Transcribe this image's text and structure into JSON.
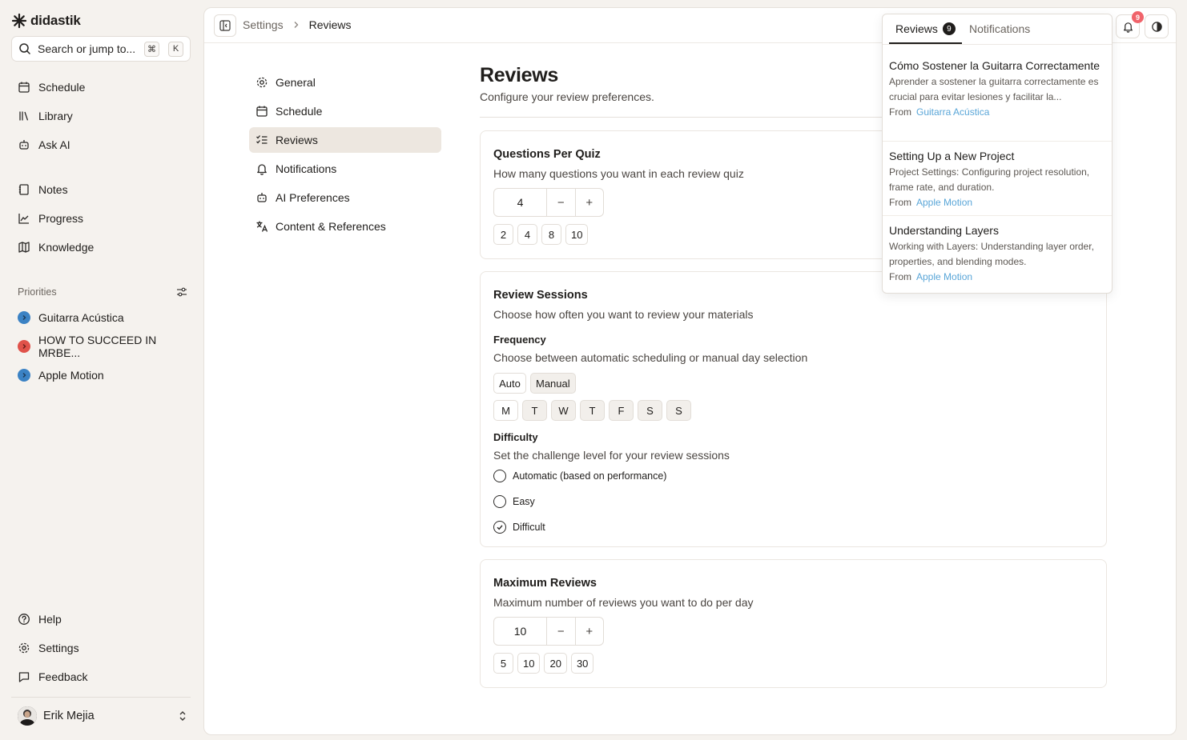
{
  "app": {
    "name": "didastik"
  },
  "search": {
    "placeholder": "Search or jump to...",
    "key1": "⌘",
    "key2": "K"
  },
  "sidebar": {
    "primary": [
      {
        "label": "Schedule",
        "icon": "calendar-icon"
      },
      {
        "label": "Library",
        "icon": "library-icon"
      },
      {
        "label": "Ask AI",
        "icon": "bot-icon"
      }
    ],
    "secondary": [
      {
        "label": "Notes",
        "icon": "notebook-icon"
      },
      {
        "label": "Progress",
        "icon": "chart-icon"
      },
      {
        "label": "Knowledge",
        "icon": "map-icon"
      }
    ],
    "priorities_label": "Priorities",
    "priorities": [
      {
        "label": "Guitarra Acústica",
        "color": "#3b82c4"
      },
      {
        "label": "HOW TO SUCCEED IN MRBE...",
        "color": "#e0524a"
      },
      {
        "label": "Apple Motion",
        "color": "#3b82c4"
      }
    ],
    "footer": [
      {
        "label": "Help",
        "icon": "help-circle-icon"
      },
      {
        "label": "Settings",
        "icon": "gear-icon"
      },
      {
        "label": "Feedback",
        "icon": "message-icon"
      }
    ],
    "user": {
      "name": "Erik Mejia"
    }
  },
  "breadcrumb": {
    "root": "Settings",
    "current": "Reviews"
  },
  "notifications": {
    "badge": "9"
  },
  "settings_nav": [
    {
      "label": "General",
      "icon": "gear-icon"
    },
    {
      "label": "Schedule",
      "icon": "calendar-icon"
    },
    {
      "label": "Reviews",
      "icon": "list-checks-icon",
      "active": true
    },
    {
      "label": "Notifications",
      "icon": "bell-icon"
    },
    {
      "label": "AI Preferences",
      "icon": "bot-icon"
    },
    {
      "label": "Content & References",
      "icon": "languages-icon"
    }
  ],
  "page": {
    "title": "Reviews",
    "subtitle": "Configure your review preferences."
  },
  "questions_per_quiz": {
    "title": "Questions Per Quiz",
    "description": "How many questions you want in each review quiz",
    "value": "4",
    "minus": "−",
    "plus": "+",
    "presets": [
      "2",
      "4",
      "8",
      "10"
    ]
  },
  "review_sessions": {
    "title": "Review Sessions",
    "description": "Choose how often you want to review your materials",
    "frequency_label": "Frequency",
    "frequency_desc": "Choose between automatic scheduling or manual day selection",
    "modes": [
      "Auto",
      "Manual"
    ],
    "selected_mode": "Manual",
    "days": [
      "M",
      "T",
      "W",
      "T",
      "F",
      "S",
      "S"
    ],
    "difficulty_label": "Difficulty",
    "difficulty_desc": "Set the challenge level for your review sessions",
    "difficulty_options": [
      "Automatic (based on performance)",
      "Easy",
      "Difficult"
    ],
    "difficulty_selected": "Difficult"
  },
  "maximum_reviews": {
    "title": "Maximum Reviews",
    "description": "Maximum number of reviews you want to do per day",
    "value": "10",
    "minus": "−",
    "plus": "+",
    "presets": [
      "5",
      "10",
      "20",
      "30"
    ]
  },
  "popover": {
    "tab_reviews": "Reviews",
    "tab_reviews_count": "9",
    "tab_notifications": "Notifications",
    "from_label": "From",
    "items": [
      {
        "title": "Cómo Sostener la Guitarra Correctamente",
        "body": "Aprender a sostener la guitarra correctamente es crucial para evitar lesiones y facilitar la...",
        "source": "Guitarra Acústica"
      },
      {
        "title": "Setting Up a New Project",
        "body": "Project Settings: Configuring project resolution, frame rate, and duration.",
        "source": "Apple Motion"
      },
      {
        "title": "Understanding Layers",
        "body": "Working with Layers: Understanding layer order, properties, and blending modes.",
        "source": "Apple Motion"
      }
    ]
  }
}
